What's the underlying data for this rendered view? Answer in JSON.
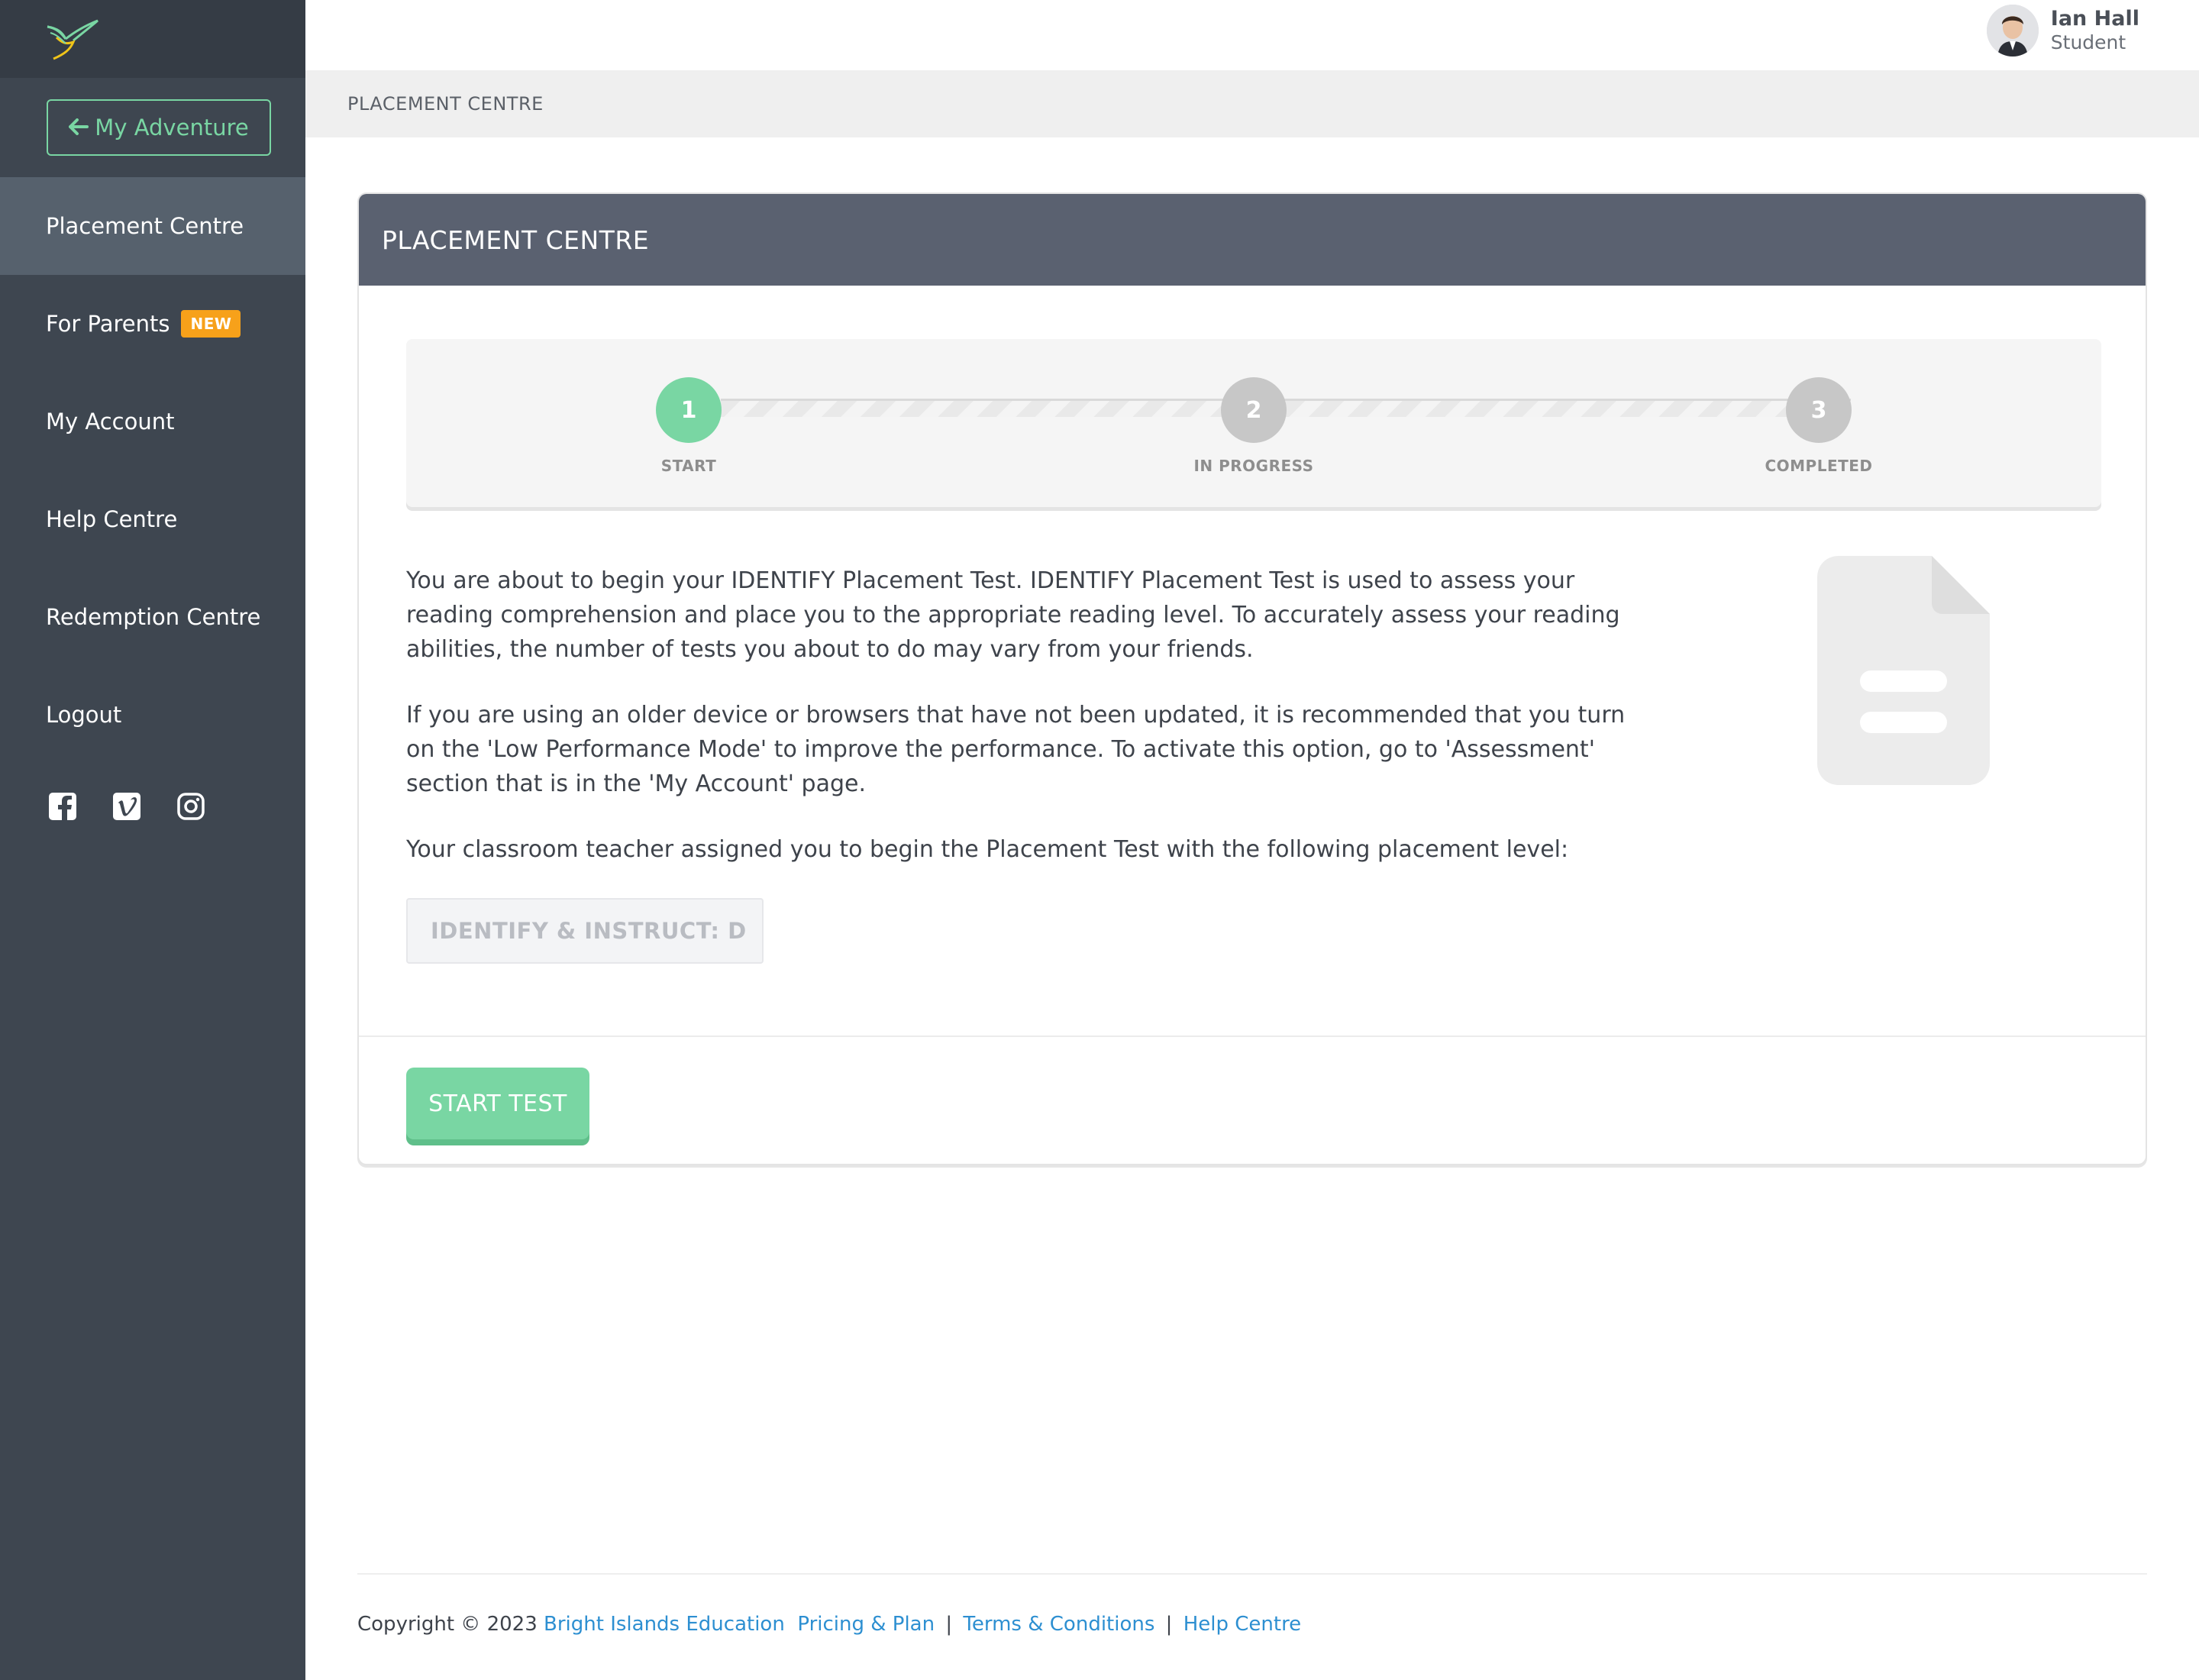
{
  "sidebar": {
    "logo_icon": "hummingbird-logo",
    "back_button": {
      "icon": "arrow-left-icon",
      "label": "My Adventure"
    },
    "items": [
      {
        "label": "Placement Centre",
        "active": true
      },
      {
        "label": "For Parents",
        "badge": "NEW"
      },
      {
        "label": "My Account"
      },
      {
        "label": "Help Centre"
      },
      {
        "label": "Redemption Centre"
      },
      {
        "label": "Logout"
      }
    ],
    "social": [
      "facebook-icon",
      "vimeo-icon",
      "instagram-icon"
    ]
  },
  "user": {
    "name": "Ian Hall",
    "role": "Student"
  },
  "breadcrumb": "PLACEMENT CENTRE",
  "card": {
    "title": "PLACEMENT CENTRE",
    "steps": [
      {
        "number": "1",
        "label": "START",
        "state": "current"
      },
      {
        "number": "2",
        "label": "IN PROGRESS",
        "state": "pending"
      },
      {
        "number": "3",
        "label": "COMPLETED",
        "state": "pending"
      }
    ],
    "paragraphs": [
      "You are about to begin your IDENTIFY Placement Test. IDENTIFY Placement Test is used to assess your reading comprehension and place you to the appropriate reading level. To accurately assess your reading abilities, the number of tests you about to do may vary from your friends.",
      "If you are using an older device or browsers that have not been updated, it is recommended that you turn on the 'Low Performance Mode' to improve the performance. To activate this option, go to 'Assessment' section that is in the 'My Account' page.",
      "Your classroom teacher assigned you to begin the Placement Test with the following placement level:"
    ],
    "placement_level": "IDENTIFY & INSTRUCT: D",
    "doc_icon": "document-icon",
    "start_button": "START TEST"
  },
  "footer": {
    "copyright": "Copyright © 2023",
    "links": [
      "Bright Islands Education",
      "Pricing & Plan",
      "Terms & Conditions",
      "Help Centre"
    ],
    "separator": "|"
  },
  "colors": {
    "sidebar_bg": "#3e4650",
    "accent_green": "#79d6a3",
    "badge_orange": "#f7a11a",
    "card_header": "#5a6170",
    "link_blue": "#2d8fd1"
  }
}
